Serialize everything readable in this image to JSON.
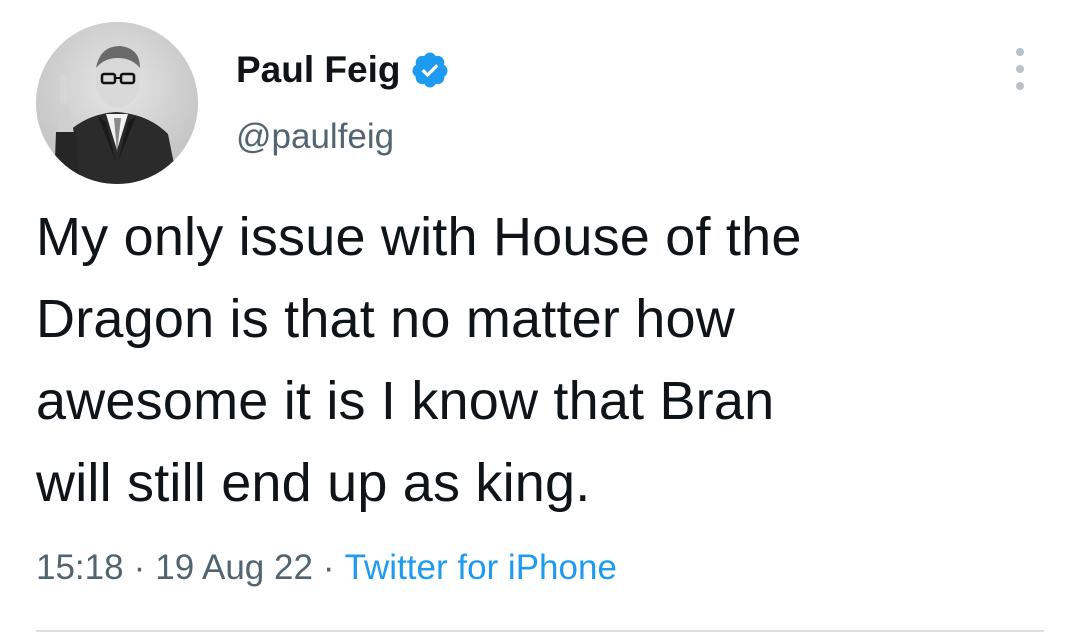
{
  "author": {
    "display_name": "Paul Feig",
    "handle": "@paulfeig",
    "verified": true,
    "verified_color": "#1d9bf0"
  },
  "tweet": {
    "text": "My only issue with House of the\nDragon is that no matter how\nawesome it is I know that Bran\nwill still end up as king."
  },
  "meta": {
    "time": "15:18",
    "separator": "·",
    "date": "19 Aug 22",
    "source": "Twitter for iPhone"
  },
  "icons": {
    "verified": "verified-badge-icon",
    "more": "more-options-icon"
  },
  "colors": {
    "text": "#0f1419",
    "secondary": "#536471",
    "link": "#1d9bf0"
  }
}
